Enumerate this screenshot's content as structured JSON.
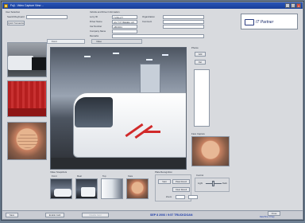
{
  "window": {
    "title": "Fuji - Video Capture View ..."
  },
  "form": {
    "user_label": "User Selection",
    "lookup_label": "Search/Keyboard",
    "quick_button": "Quick Transaction",
    "group_label": "Vehicle and Driver Information",
    "reg_label": "Lorry ID",
    "reg_value": "TL58-177",
    "name_label": "Driver Name",
    "name_value": "HG TOT BEEEE 123",
    "id_label": "Car Number",
    "id_value": "ABCD01",
    "firm_label": "Company Name",
    "right_label1": "Organization",
    "right_label2": "Comment",
    "extra_label": "Remarks"
  },
  "logo": {
    "text": "IT Partner"
  },
  "tabs": [
    {
      "label": "Front"
    },
    {
      "label": "Video"
    }
  ],
  "panels": {
    "photo_label": "Photos",
    "photo_add": "Add",
    "photo_del": "Del",
    "face_label": "Face Capture",
    "snapshots_label": "Video Snapshots",
    "snap_labels": [
      "Front",
      "Rear",
      "Top",
      "Face"
    ],
    "plate_label": "Plate Recognition",
    "plate_btn1": "Start",
    "plate_btn2": "Plate Result",
    "plate_btn3": "Clear Result",
    "control_label": "Control",
    "control_left": "Light",
    "control_right": "Dark",
    "zoom_label": "Zoom"
  },
  "status": {
    "save_label": "Save",
    "enable_label": "Enable Card",
    "disable_label": "Disable Card",
    "date_text": "SEP 8 2006 / 9:57  TRUCKDOAN",
    "right_label": "Close",
    "right_small": "Date/Time: 8 Sep"
  },
  "colors": {
    "titlebar": "#1f48a8",
    "background": "#d8dade",
    "status_text": "#1b3aa8"
  }
}
